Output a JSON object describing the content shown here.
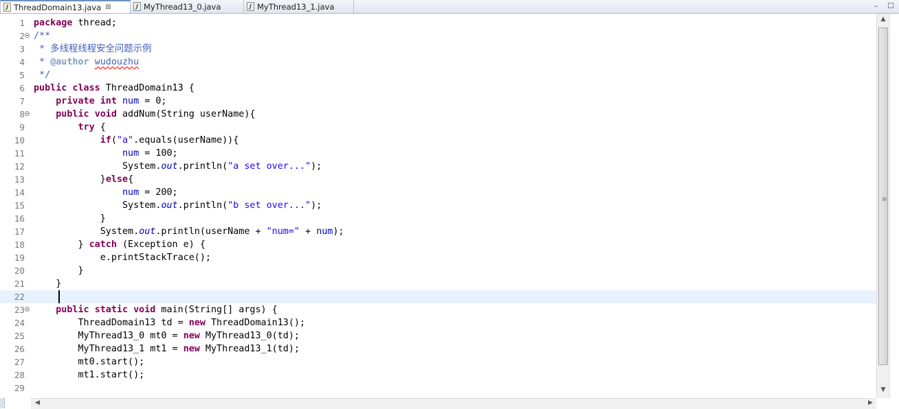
{
  "tabs": [
    {
      "label": "ThreadDomain13.java",
      "close": "⊠",
      "active": true
    },
    {
      "label": "MyThread13_0.java",
      "active": false
    },
    {
      "label": "MyThread13_1.java",
      "active": false
    }
  ],
  "window_controls": {
    "minimize": "–",
    "maximize": "☐"
  },
  "editor": {
    "current_line": 22,
    "fold_lines": [
      2,
      8,
      23
    ],
    "line_numbers": [
      "1",
      "2",
      "3",
      "4",
      "5",
      "6",
      "7",
      "8",
      "9",
      "10",
      "11",
      "12",
      "13",
      "14",
      "15",
      "16",
      "17",
      "18",
      "19",
      "20",
      "21",
      "22",
      "23",
      "24",
      "25",
      "26",
      "27",
      "28",
      "29"
    ],
    "tok": {
      "package": "package",
      "public": "public",
      "class": "class",
      "private": "private",
      "int": "int",
      "void": "void",
      "try": "try",
      "if": "if",
      "else": "else",
      "catch": "catch",
      "static": "static",
      "new": "new",
      "num": "num",
      "out": "out",
      "author_tag": "@author",
      "author_name": "wudouzhu",
      "str_a": "\"a\"",
      "str_a_set": "\"a set over...\"",
      "str_b_set": "\"b set over...\"",
      "str_num": "\"num=\"",
      "l1_rest": " thread;",
      "l2": "/**",
      "l3": " * 多线程线程安全问题示例",
      "l4_pre": " * ",
      "l5": " */",
      "l6_rest": " ThreadDomain13 {",
      "l7_rest": " = 0;",
      "l8_rest": " addNum(String userName){",
      "l9_rest": " {",
      "l10_a": "(",
      "l10_b": ".equals(userName)){",
      "l11_rest": " = 100;",
      "l12_a": "System.",
      "l12_b": ".println(",
      "l12_c": ");",
      "l13_a": "}",
      "l13_b": "{",
      "l14_rest": " = 200;",
      "l16": "}",
      "l17_b": ".println(userName + ",
      "l17_c": " + ",
      "l17_d": ");",
      "l18_a": "} ",
      "l18_b": " (Exception e) {",
      "l19": "e.printStackTrace();",
      "l20": "}",
      "l21": "}",
      "l23_rest": " main(String[] args) {",
      "l24_a": "ThreadDomain13 td = ",
      "l24_b": " ThreadDomain13();",
      "l25_a": "MyThread13_0 mt0 = ",
      "l25_b": " MyThread13_0(td);",
      "l26_a": "MyThread13_1 mt1 = ",
      "l26_b": " MyThread13_1(td);",
      "l27": "mt0.start();",
      "l28": "mt1.start();"
    }
  },
  "scrollbar": {
    "up": "▲",
    "down": "▼",
    "left": "◀",
    "right": "▶",
    "grip": "≡"
  }
}
